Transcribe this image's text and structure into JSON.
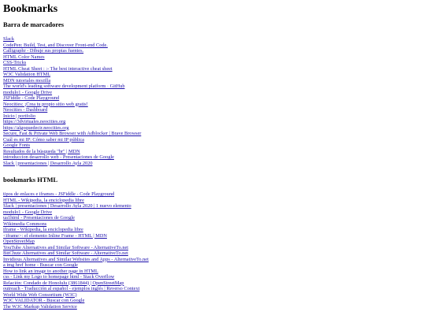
{
  "page_title": "Bookmarks",
  "sections": [
    {
      "heading": "Barra de marcadores",
      "links": [
        "Slack",
        "CodePen: Build, Test, and Discover Front-end Code.",
        "Calligraphr - Dibuje sus propias fuentes.",
        "HTML Color Names",
        "CSS-Tricks",
        "HTML Cheat Sheet : :- The best interactive cheat sheet",
        "W3C Validation HTML",
        "MDN tutoriales mozilla",
        "The world's leading software development platform · GitHub",
        "modulo1 - Google Drive",
        "JSFiddle - Code Playground",
        "Neocities: ¡Crea tu propio sitio web gratis!",
        "Neocities - Dashboard",
        "Inicio | portfolio",
        "https://3dvirtuales.neocities.org",
        "https://algoquedecir.neocities.org",
        "Secure, Fast & Private Web Browser with Adblocker | Brave Browser",
        "Cuál es mi IP: Cómo saber mi IP pública",
        "Google Fonts",
        "Resultados de la búsqueda \"br\" | MDN",
        "introduccion desarrollo web - Presentaciones de Google",
        "Slack | presentaciones | Desarrollo Ayla 2020"
      ]
    },
    {
      "heading": "bookmarks HTML",
      "links": [
        "tipos de enlaces e iframes - JSFiddle - Code Playground",
        "HTML - Wikipedia, la enciclopedia libre",
        "Slack | presentaciones | Desarrollo Ayla 2020 | 1 nuevo elemento",
        "modulo1 - Google Drive",
        "ua1html - Presentaciones de Google",
        "Wikimedia Commons",
        "iframe - Wikipedia, la enciclopedia libre",
        "<iframe>: el elemento Inline Frame - HTML | MDN",
        "OpenStreetMap",
        "YouTube Alternatives and Similar Software - AlternativeTo.net",
        "BitChute Alternatives and Similar Software - AlternativeTo.net",
        "Invidious Alternatives and Similar Websites and Apps - AlternativeTo.net",
        "a img href home - Buscar con Google",
        "How to link an image to another page in HTML",
        "css - Link my Logo to homepage html - Stack Overflow",
        "Relación: Condado de Honolulu (3861844) | OpenStreetMap",
        "outreach - Traducción al español - ejemplos inglés | Reverso Context",
        "World Wide Web Consortium (W3C)",
        "W3C VALIDATOR - Buscar con Google",
        "The W3C Markup Validation Service"
      ]
    }
  ]
}
